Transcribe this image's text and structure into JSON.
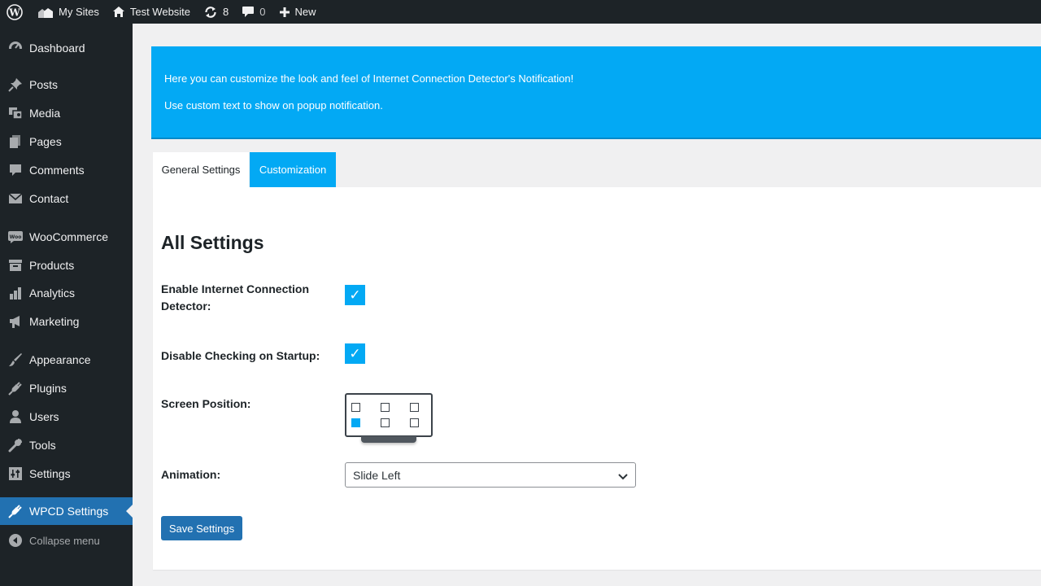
{
  "admin_bar": {
    "my_sites": "My Sites",
    "site_name": "Test Website",
    "updates_count": "8",
    "comments_count": "0",
    "new_label": "New"
  },
  "sidebar": {
    "items": [
      {
        "label": "Dashboard",
        "icon": "dashboard-icon"
      },
      {
        "label": "Posts",
        "icon": "pin-icon"
      },
      {
        "label": "Media",
        "icon": "media-icon"
      },
      {
        "label": "Pages",
        "icon": "pages-icon"
      },
      {
        "label": "Comments",
        "icon": "comment-icon"
      },
      {
        "label": "Contact",
        "icon": "mail-icon"
      },
      {
        "label": "WooCommerce",
        "icon": "woo-icon"
      },
      {
        "label": "Products",
        "icon": "archive-icon"
      },
      {
        "label": "Analytics",
        "icon": "bar-chart-icon"
      },
      {
        "label": "Marketing",
        "icon": "megaphone-icon"
      },
      {
        "label": "Appearance",
        "icon": "brush-icon"
      },
      {
        "label": "Plugins",
        "icon": "plug-icon"
      },
      {
        "label": "Users",
        "icon": "user-icon"
      },
      {
        "label": "Tools",
        "icon": "wrench-icon"
      },
      {
        "label": "Settings",
        "icon": "sliders-icon"
      },
      {
        "label": "WPCD Settings",
        "icon": "plug-icon",
        "current": true
      }
    ],
    "collapse_label": "Collapse menu"
  },
  "banner": {
    "line1": "Here you can customize the look and feel of Internet Connection Detector's Notification!",
    "line2": "Use custom text to show on popup notification."
  },
  "tabs": [
    {
      "label": "General Settings",
      "active": true
    },
    {
      "label": "Customization",
      "active": false
    }
  ],
  "settings": {
    "title": "All Settings",
    "enable_label": "Enable Internet Connection Detector:",
    "enable_checked": true,
    "disable_startup_label": "Disable Checking on Startup:",
    "disable_startup_checked": true,
    "checkmark": "✓",
    "screen_position_label": "Screen Position:",
    "screen_position_selected": "bottom-left",
    "animation_label": "Animation:",
    "animation_value": "Slide Left",
    "save_label": "Save Settings"
  },
  "colors": {
    "accent": "#03a9f4",
    "admin_dark": "#1d2327",
    "primary_button": "#2271b1"
  }
}
